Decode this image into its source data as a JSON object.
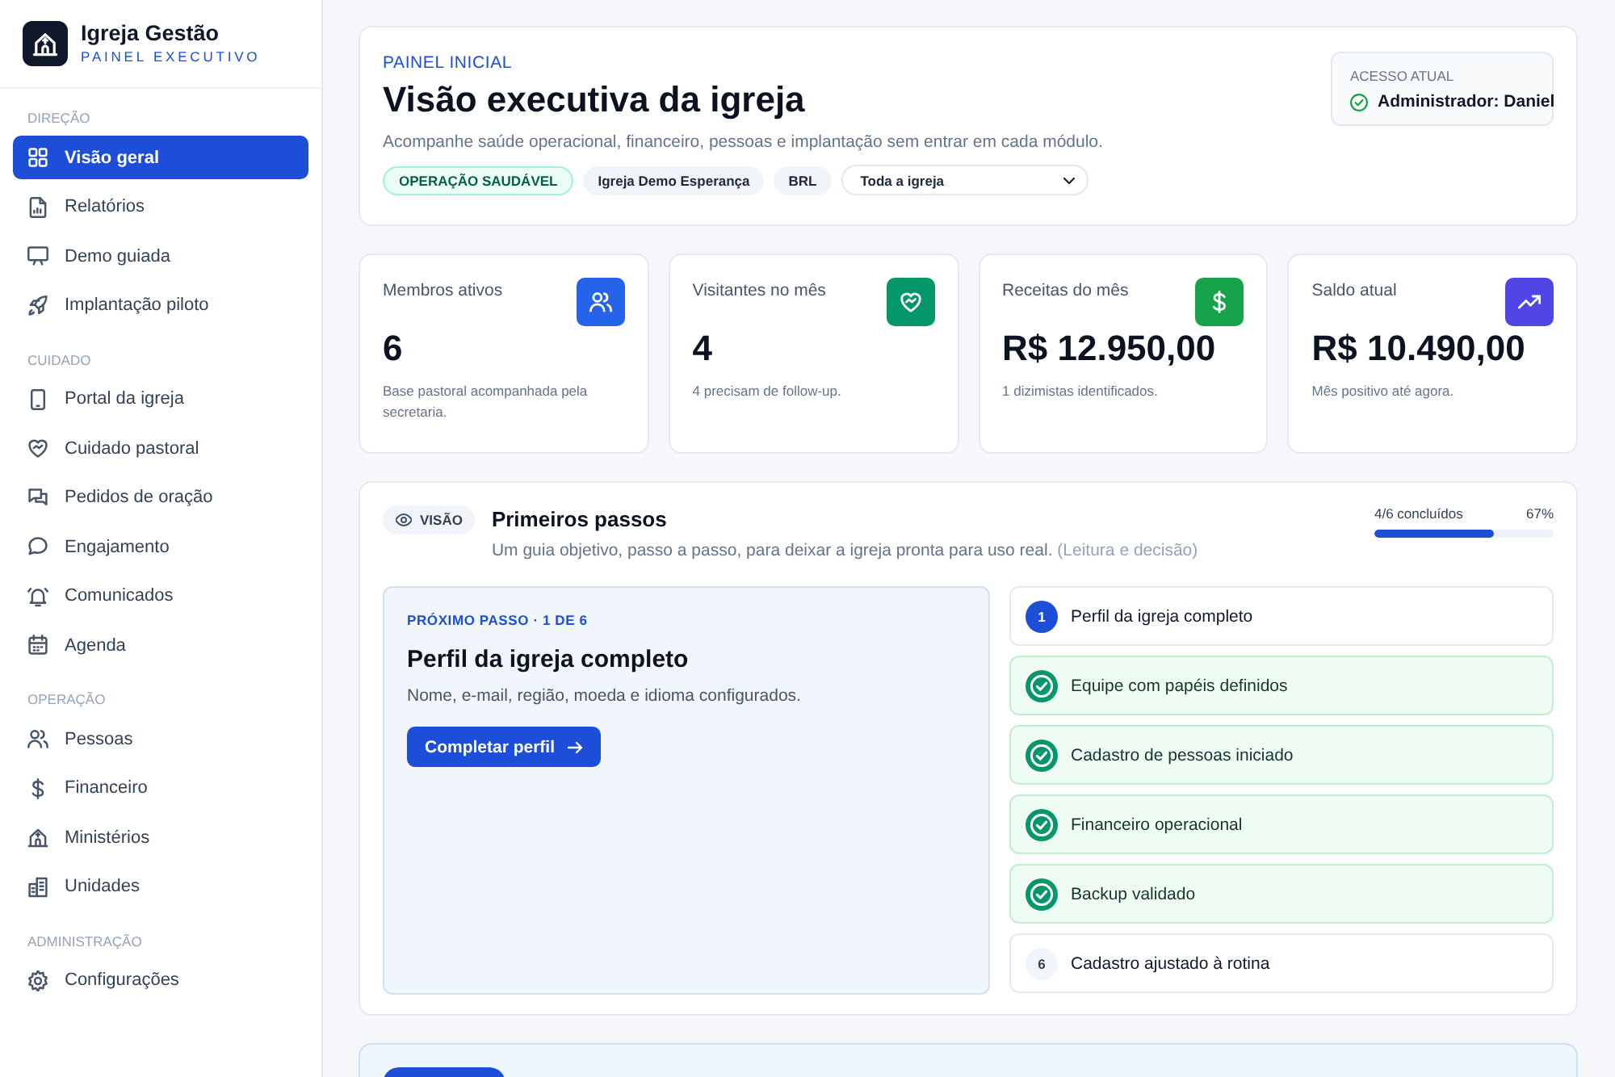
{
  "sidebar": {
    "brand": {
      "title": "Igreja Gestão",
      "subtitle": "PAINEL EXECUTIVO"
    },
    "sections": [
      {
        "heading": "DIREÇÃO",
        "items": [
          {
            "label": "Visão geral",
            "selected": true
          },
          {
            "label": "Relatórios",
            "selected": false
          },
          {
            "label": "Demo guiada",
            "selected": false
          },
          {
            "label": "Implantação piloto",
            "selected": false
          }
        ]
      },
      {
        "heading": "CUIDADO",
        "items": [
          {
            "label": "Portal da igreja",
            "selected": false
          },
          {
            "label": "Cuidado pastoral",
            "selected": false
          },
          {
            "label": "Pedidos de oração",
            "selected": false
          },
          {
            "label": "Engajamento",
            "selected": false
          },
          {
            "label": "Comunicados",
            "selected": false
          },
          {
            "label": "Agenda",
            "selected": false
          }
        ]
      },
      {
        "heading": "OPERAÇÃO",
        "items": [
          {
            "label": "Pessoas",
            "selected": false
          },
          {
            "label": "Financeiro",
            "selected": false
          },
          {
            "label": "Ministérios",
            "selected": false
          },
          {
            "label": "Unidades",
            "selected": false
          }
        ]
      },
      {
        "heading": "ADMINISTRAÇÃO",
        "items": [
          {
            "label": "Configurações",
            "selected": false
          }
        ]
      }
    ]
  },
  "header": {
    "eyebrow": "PAINEL INICIAL",
    "title": "Visão executiva da igreja",
    "subtitle": "Acompanhe saúde operacional, financeiro, pessoas e implantação sem entrar em cada módulo.",
    "chips": [
      {
        "label": "OPERAÇÃO SAUDÁVEL",
        "kind": "status"
      },
      {
        "label": "Igreja Demo Esperança",
        "kind": "plain"
      },
      {
        "label": "BRL",
        "kind": "plain"
      }
    ],
    "scope_select": {
      "value": "Toda a igreja"
    },
    "access": {
      "label": "ACESSO ATUAL",
      "value": "Administrador: Daniel"
    }
  },
  "stats": [
    {
      "label": "Membros ativos",
      "value": "6",
      "note": "Base pastoral acompanhada pela secretaria.",
      "color": "#2563eb"
    },
    {
      "label": "Visitantes no mês",
      "value": "4",
      "note": "4 precisam de follow-up.",
      "color": "#059669"
    },
    {
      "label": "Receitas do mês",
      "value": "R$ 12.950,00",
      "note": "1 dizimistas identificados.",
      "color": "#16a34a"
    },
    {
      "label": "Saldo atual",
      "value": "R$ 10.490,00",
      "note": "Mês positivo até agora.",
      "color": "#4f46e5"
    }
  ],
  "first_steps": {
    "tag": "VISÃO",
    "title": "Primeiros passos",
    "subtitle": "Um guia objetivo, passo a passo, para deixar a igreja pronta para uso real.",
    "hint": "(Leitura e decisão)",
    "progress": {
      "label": "4/6 concluídos",
      "percent": "67%",
      "level": 0.67
    },
    "next_step": {
      "eyebrow": "PRÓXIMO PASSO · 1 DE 6",
      "title": "Perfil da igreja completo",
      "description": "Nome, e-mail, região, moeda e idioma configurados.",
      "button": "Completar perfil"
    },
    "steps": [
      {
        "label": "Perfil da igreja completo",
        "kind": "current",
        "number": "1"
      },
      {
        "label": "Equipe com papéis definidos",
        "kind": "done"
      },
      {
        "label": "Cadastro de pessoas iniciado",
        "kind": "done"
      },
      {
        "label": "Financeiro operacional",
        "kind": "done"
      },
      {
        "label": "Backup validado",
        "kind": "done"
      },
      {
        "label": "Cadastro ajustado à rotina",
        "kind": "pending",
        "number": "6"
      }
    ]
  }
}
